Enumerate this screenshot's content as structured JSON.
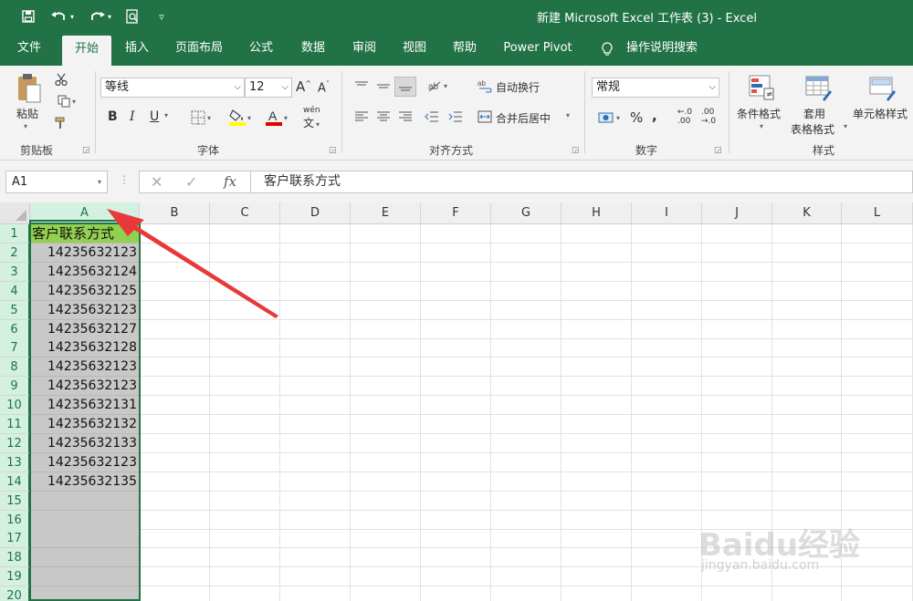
{
  "title_bar": {
    "title": "新建 Microsoft Excel 工作表 (3)  -  Excel",
    "qa_icons": [
      "save-icon",
      "undo-icon",
      "redo-icon",
      "print-preview-icon",
      "customize-qat-icon"
    ]
  },
  "tabs": [
    "文件",
    "开始",
    "插入",
    "页面布局",
    "公式",
    "数据",
    "审阅",
    "视图",
    "帮助",
    "Power Pivot",
    "操作说明搜索"
  ],
  "ribbon": {
    "clipboard": {
      "paste": "粘贴",
      "label": "剪贴板"
    },
    "font": {
      "font_name": "等线",
      "font_size": "12",
      "bold": "B",
      "italic": "I",
      "underline": "U",
      "font_color": "A",
      "phonetic": "wén",
      "label": "字体",
      "grow": "A",
      "shrink": "A"
    },
    "alignment": {
      "wrap": "自动换行",
      "merge": "合并后居中",
      "label": "对齐方式"
    },
    "number": {
      "format": "常规",
      "percent": "%",
      "comma": ",",
      "label": "数字"
    },
    "styles": {
      "conditional": "条件格式",
      "table": "套用\n表格格式",
      "table_line1": "套用",
      "table_line2": "表格格式",
      "cell_styles": "单元格样式",
      "label": "样式"
    }
  },
  "formula_bar": {
    "name_box": "A1",
    "fx": "fx",
    "content": "客户联系方式"
  },
  "columns": [
    "A",
    "B",
    "C",
    "D",
    "E",
    "F",
    "G",
    "H",
    "I",
    "J",
    "K",
    "L"
  ],
  "rows": [
    "1",
    "2",
    "3",
    "4",
    "5",
    "6",
    "7",
    "8",
    "9",
    "10",
    "11",
    "12",
    "13",
    "14",
    "15",
    "16",
    "17",
    "18",
    "19",
    "20"
  ],
  "column_a": [
    "客户联系方式",
    "14235632123",
    "14235632124",
    "14235632125",
    "14235632123",
    "14235632127",
    "14235632128",
    "14235632123",
    "14235632123",
    "14235632131",
    "14235632132",
    "14235632133",
    "14235632123",
    "14235632135",
    "",
    "",
    "",
    "",
    "",
    ""
  ],
  "watermark": {
    "brand": "Baidu经验",
    "url": "jingyan.baidu.com"
  },
  "colors": {
    "excel_green": "#217346",
    "header_fill": "#92d050",
    "selection_fill": "#c8c8c8",
    "arrow": "#e8383a"
  }
}
